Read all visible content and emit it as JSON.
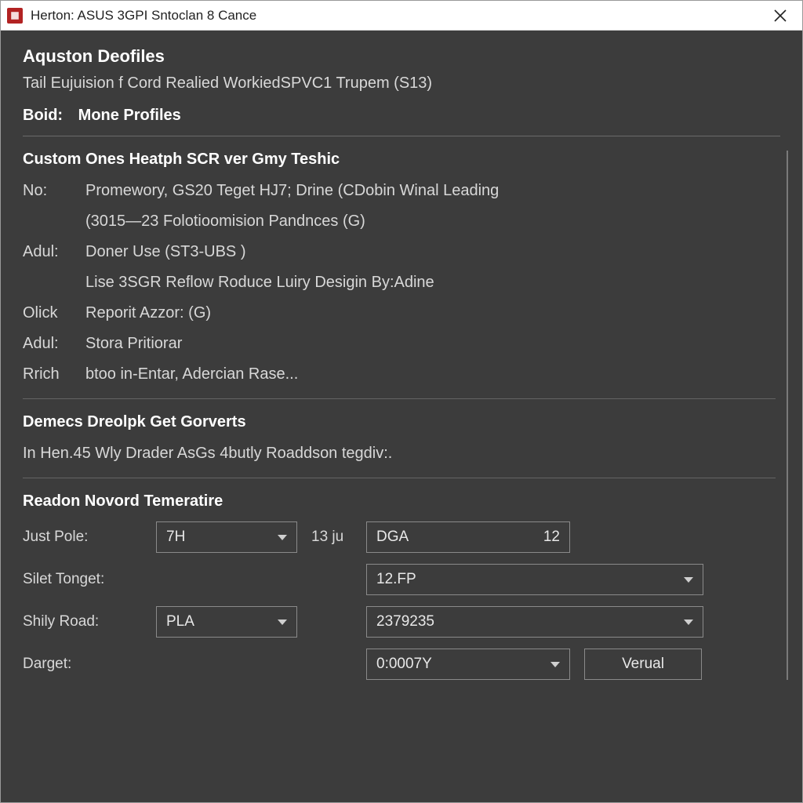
{
  "window": {
    "title": "Herton: ASUS 3GPI Sntoclan 8 Cance"
  },
  "header": {
    "title": "Aquston Deofiles",
    "subtitle": "Tail Eujuision f Cord Realied WorkiedSPVC1 Trupem (S13)",
    "boid_label": "Boid:",
    "boid_value": "Mone Profiles"
  },
  "custom": {
    "title": "Custom Ones Heatph SCR ver Gmy Teshic",
    "rows": {
      "no_label": "No:",
      "no_value": "Promewory, GS20 Teget HJ7; Drine (CDobin Winal Leading",
      "no_cont": "(3015—23 Folotioomision Pandnces (G)",
      "adul1_label": "Adul:",
      "adul1_value": "Doner Use (ST3-UBS )",
      "adul1_cont": "Lise 3SGR Reflow Roduce Luiry Desigin By:Adine",
      "olick_label": "Olick",
      "olick_value": "Reporit Azzor: (G)",
      "adul2_label": "Adul:",
      "adul2_value": "Stora Pritiorar",
      "rrich_label": "Rrich",
      "rrich_value": "btoo in-Entar, Adercian Rase..."
    }
  },
  "demecs": {
    "title": "Demecs Dreolpk Get Gorverts",
    "text": "In Hen.45 Wly Drader AsGs 4butly Roaddson tegdiv:."
  },
  "readon": {
    "title": "Readon Novord Temeratire",
    "just_pole_label": "Just Pole:",
    "just_pole_combo": "7H",
    "just_pole_mid": "13 ju",
    "just_pole_box": "DGA",
    "just_pole_num": "12",
    "silet_label": "Silet Tonget:",
    "silet_combo": "12.FP",
    "shily_label": "Shily Road:",
    "shily_combo1": "PLA",
    "shily_combo2": "2379235",
    "darget_label": "Darget:",
    "darget_combo": "0:0007Y",
    "darget_btn": "Verual"
  }
}
